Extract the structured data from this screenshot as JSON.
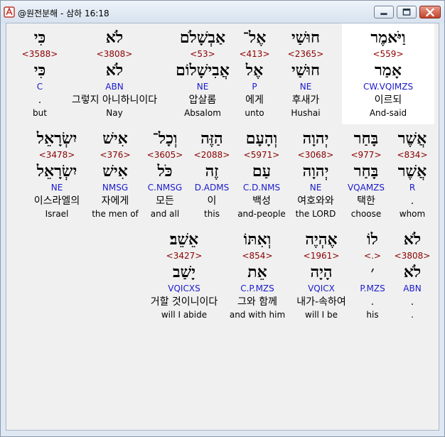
{
  "window": {
    "title": "@원전분해 - 삼하 16:18"
  },
  "colors": {
    "strong": "#8b0000",
    "parse": "#1a1acc",
    "highlight": "#ffffff"
  },
  "rows": [
    {
      "words": [
        {
          "heb": "וַיֹּאמֶר",
          "strong": "<559>",
          "lex": "אָמַר",
          "parse": "CW.VQIMZS",
          "kor": "이르되",
          "eng": "And-said",
          "highlight": true
        },
        {
          "heb": "חוּשַׁי",
          "strong": "<2365>",
          "lex": "חוּשַׁי",
          "parse": "NE",
          "kor": "후새가",
          "eng": "Hushai"
        },
        {
          "heb": "אֶל־",
          "strong": "<413>",
          "lex": "אֶל",
          "parse": "P",
          "kor": "에게",
          "eng": "unto"
        },
        {
          "heb": "אַבְשָׁלֹם",
          "strong": "<53>",
          "lex": "אֲבִישָׁלוֹם",
          "parse": "NE",
          "kor": "압살롬",
          "eng": "Absalom"
        },
        {
          "heb": "לֹא",
          "strong": "<3808>",
          "lex": "לֹא",
          "parse": "ABN",
          "kor": "그렇지 아니하니이다",
          "eng": "Nay"
        },
        {
          "heb": "כִּי",
          "strong": "<3588>",
          "lex": "כִּי",
          "parse": "C",
          "kor": ".",
          "eng": "but"
        }
      ]
    },
    {
      "words": [
        {
          "heb": "אֲשֶׁר",
          "strong": "<834>",
          "lex": "אֲשֶׁר",
          "parse": "R",
          "kor": ".",
          "eng": "whom"
        },
        {
          "heb": "בָּחַר",
          "strong": "<977>",
          "lex": "בָּחַר",
          "parse": "VQAMZS",
          "kor": "택한",
          "eng": "choose"
        },
        {
          "heb": "יְהוָה",
          "strong": "<3068>",
          "lex": "יְהוָה",
          "parse": "NE",
          "kor": "여호와와",
          "eng": "the LORD"
        },
        {
          "heb": "וְהָעָם",
          "strong": "<5971>",
          "lex": "עַם",
          "parse": "C.D.NMS",
          "kor": "백성",
          "eng": "and-people"
        },
        {
          "heb": "הַזֶּה",
          "strong": "<2088>",
          "lex": "זֶה",
          "parse": "D.ADMS",
          "kor": "이",
          "eng": "this"
        },
        {
          "heb": "וְכָל־",
          "strong": "<3605>",
          "lex": "כֹּל",
          "parse": "C.NMSG",
          "kor": "모든",
          "eng": "and all"
        },
        {
          "heb": "אִישׁ",
          "strong": "<376>",
          "lex": "אִישׁ",
          "parse": "NMSG",
          "kor": "자에게",
          "eng": "the men of"
        },
        {
          "heb": "יִשְׂרָאֵל",
          "strong": "<3478>",
          "lex": "יִשְׂרָאֵל",
          "parse": "NE",
          "kor": "이스라엘의",
          "eng": "Israel"
        }
      ]
    },
    {
      "words": [
        {
          "heb": "לֹא",
          "strong": "<3808>",
          "lex": "לֹא",
          "parse": "ABN",
          "kor": ".",
          "eng": "."
        },
        {
          "heb": "לוֹ",
          "strong": "<.>",
          "lex": "׳",
          "parse": "P.MZS",
          "kor": ".",
          "eng": "his"
        },
        {
          "heb": "אֶהְיֶה",
          "strong": "<1961>",
          "lex": "הָיָה",
          "parse": "VQICX",
          "kor": "내가-속하여",
          "eng": "will I be"
        },
        {
          "heb": "וְאִתּוֹ",
          "strong": "<854>",
          "lex": "אֵת",
          "parse": "C.P.MZS",
          "kor": "그와 함께",
          "eng": "and with him"
        },
        {
          "heb": "אֵשֵׁב׃",
          "strong": "<3427>",
          "lex": "יָשַׁב",
          "parse": "VQICXS",
          "kor": "거할 것이니이다",
          "eng": "will I abide"
        }
      ]
    }
  ]
}
